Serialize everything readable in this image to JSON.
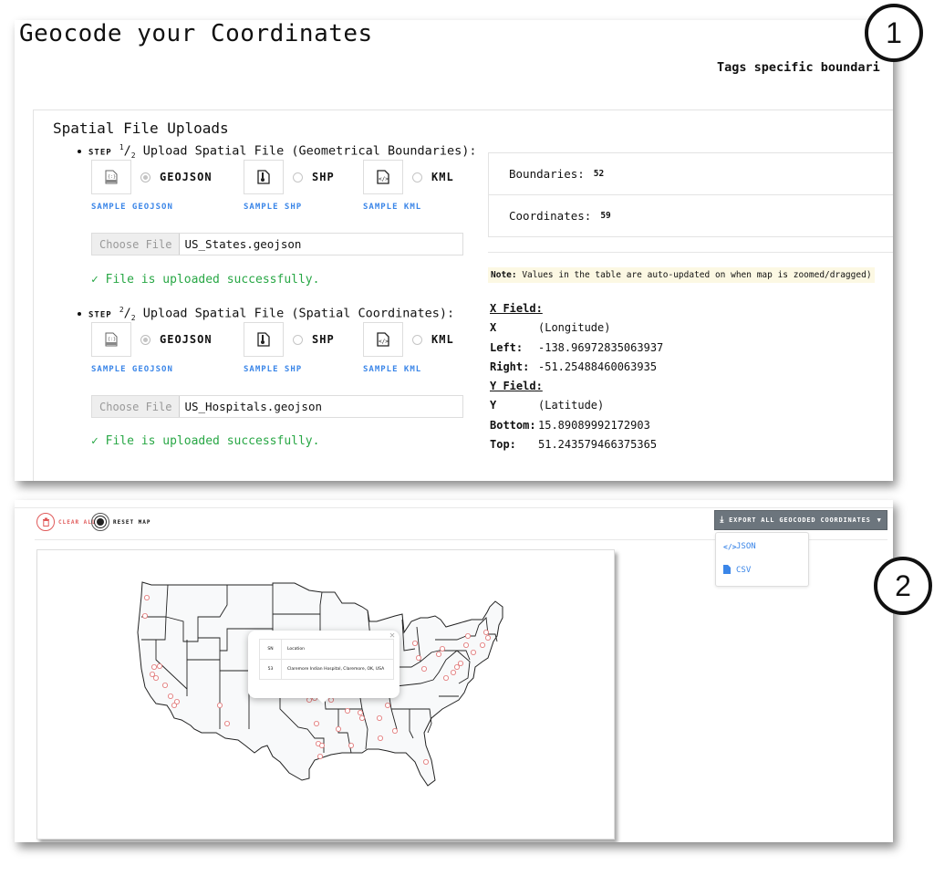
{
  "page": {
    "title": "Geocode your Coordinates",
    "tagline": "Tags specific boundari"
  },
  "uploads": {
    "section_title": "Spatial File Uploads",
    "steps": [
      {
        "step_word": "STEP",
        "step_num": "1",
        "step_den": "2",
        "label": "Upload Spatial File (Geometrical Boundaries):",
        "file_types": [
          {
            "icon": "geojson-file-icon",
            "label": "GEOJSON",
            "checked": true,
            "sample_label": "SAMPLE GEOJSON"
          },
          {
            "icon": "zip-file-icon",
            "label": "SHP",
            "checked": false,
            "sample_label": "SAMPLE SHP"
          },
          {
            "icon": "code-file-icon",
            "label": "KML",
            "checked": false,
            "sample_label": "SAMPLE KML"
          }
        ],
        "choose_file_label": "Choose File",
        "file_name": "US_States.geojson",
        "status": "✓ File is uploaded successfully."
      },
      {
        "step_word": "STEP",
        "step_num": "2",
        "step_den": "2",
        "label": "Upload Spatial File (Spatial Coordinates):",
        "file_types": [
          {
            "icon": "geojson-file-icon",
            "label": "GEOJSON",
            "checked": true,
            "sample_label": "SAMPLE GEOJSON"
          },
          {
            "icon": "zip-file-icon",
            "label": "SHP",
            "checked": false,
            "sample_label": "SAMPLE SHP"
          },
          {
            "icon": "code-file-icon",
            "label": "KML",
            "checked": false,
            "sample_label": "SAMPLE KML"
          }
        ],
        "choose_file_label": "Choose File",
        "file_name": "US_Hospitals.geojson",
        "status": "✓ File is uploaded successfully."
      }
    ]
  },
  "stats": {
    "boundaries_label": "Boundaries:",
    "boundaries_value": "52",
    "coordinates_label": "Coordinates:",
    "coordinates_value": "59"
  },
  "note": {
    "prefix": "Note:",
    "text": " Values in the table are auto-updated on when map is zoomed/dragged)"
  },
  "fields": {
    "x_header": "X Field:",
    "x_key": "X",
    "x_value": "(Longitude)",
    "left_key": "Left:",
    "left_value": "-138.96972835063937",
    "right_key": "Right:",
    "right_value": "-51.25488460063935",
    "y_header": "Y Field:",
    "y_key": "Y",
    "y_value": "(Latitude)",
    "bottom_key": "Bottom:",
    "bottom_value": "15.89089992172903",
    "top_key": "Top:",
    "top_value": "51.243579466375365"
  },
  "map_toolbar": {
    "clear_all_label": "CLEAR ALL",
    "reset_map_label": "RESET MAP",
    "export_label": "EXPORT ALL GEOCODED COORDINATES",
    "export_options": [
      {
        "icon": "code-icon",
        "label": "JSON"
      },
      {
        "icon": "file-icon",
        "label": "CSV"
      }
    ]
  },
  "map_popup": {
    "headers": [
      "SN",
      "Location"
    ],
    "row": [
      "53",
      "Claremore Indian Hospital, Claremore, OK, USA"
    ]
  },
  "callouts": [
    "1",
    "2"
  ],
  "colors": {
    "success": "#28a745",
    "link": "#3b86e8",
    "danger": "#e05a5a",
    "export_button": "#6c757d",
    "note_bg": "#fcf8e3"
  }
}
